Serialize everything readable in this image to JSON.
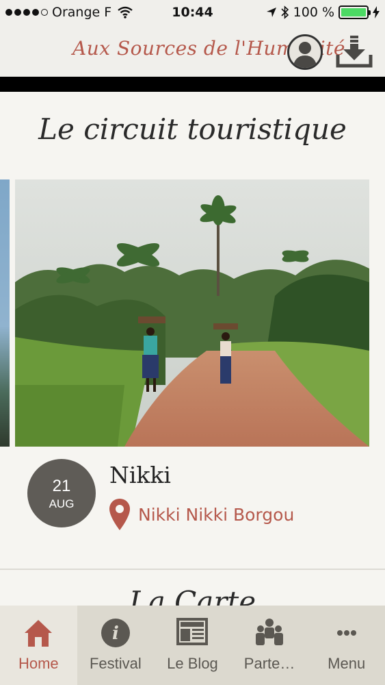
{
  "status_bar": {
    "carrier": "Orange F",
    "time": "10:44",
    "battery": "100 %",
    "battery_level": 1.0
  },
  "header": {
    "brand": "Aux Sources de l'Humanité"
  },
  "main": {
    "section_title": "Le circuit touristique",
    "next_section_title": "La Carte",
    "event": {
      "day": "21",
      "month": "AUG",
      "title": "Nikki",
      "location": "Nikki Nikki Borgou"
    }
  },
  "tabs": [
    {
      "label": "Home",
      "icon": "home-icon",
      "active": true
    },
    {
      "label": "Festival",
      "icon": "info-icon",
      "active": false
    },
    {
      "label": "Le Blog",
      "icon": "newspaper-icon",
      "active": false
    },
    {
      "label": "Parte…",
      "icon": "partners-icon",
      "active": false
    },
    {
      "label": "Menu",
      "icon": "more-icon",
      "active": false
    }
  ],
  "colors": {
    "accent": "#b5584b",
    "badge": "#5f5c57",
    "tab_bar": "#dcd9cf",
    "battery": "#4cd964"
  }
}
